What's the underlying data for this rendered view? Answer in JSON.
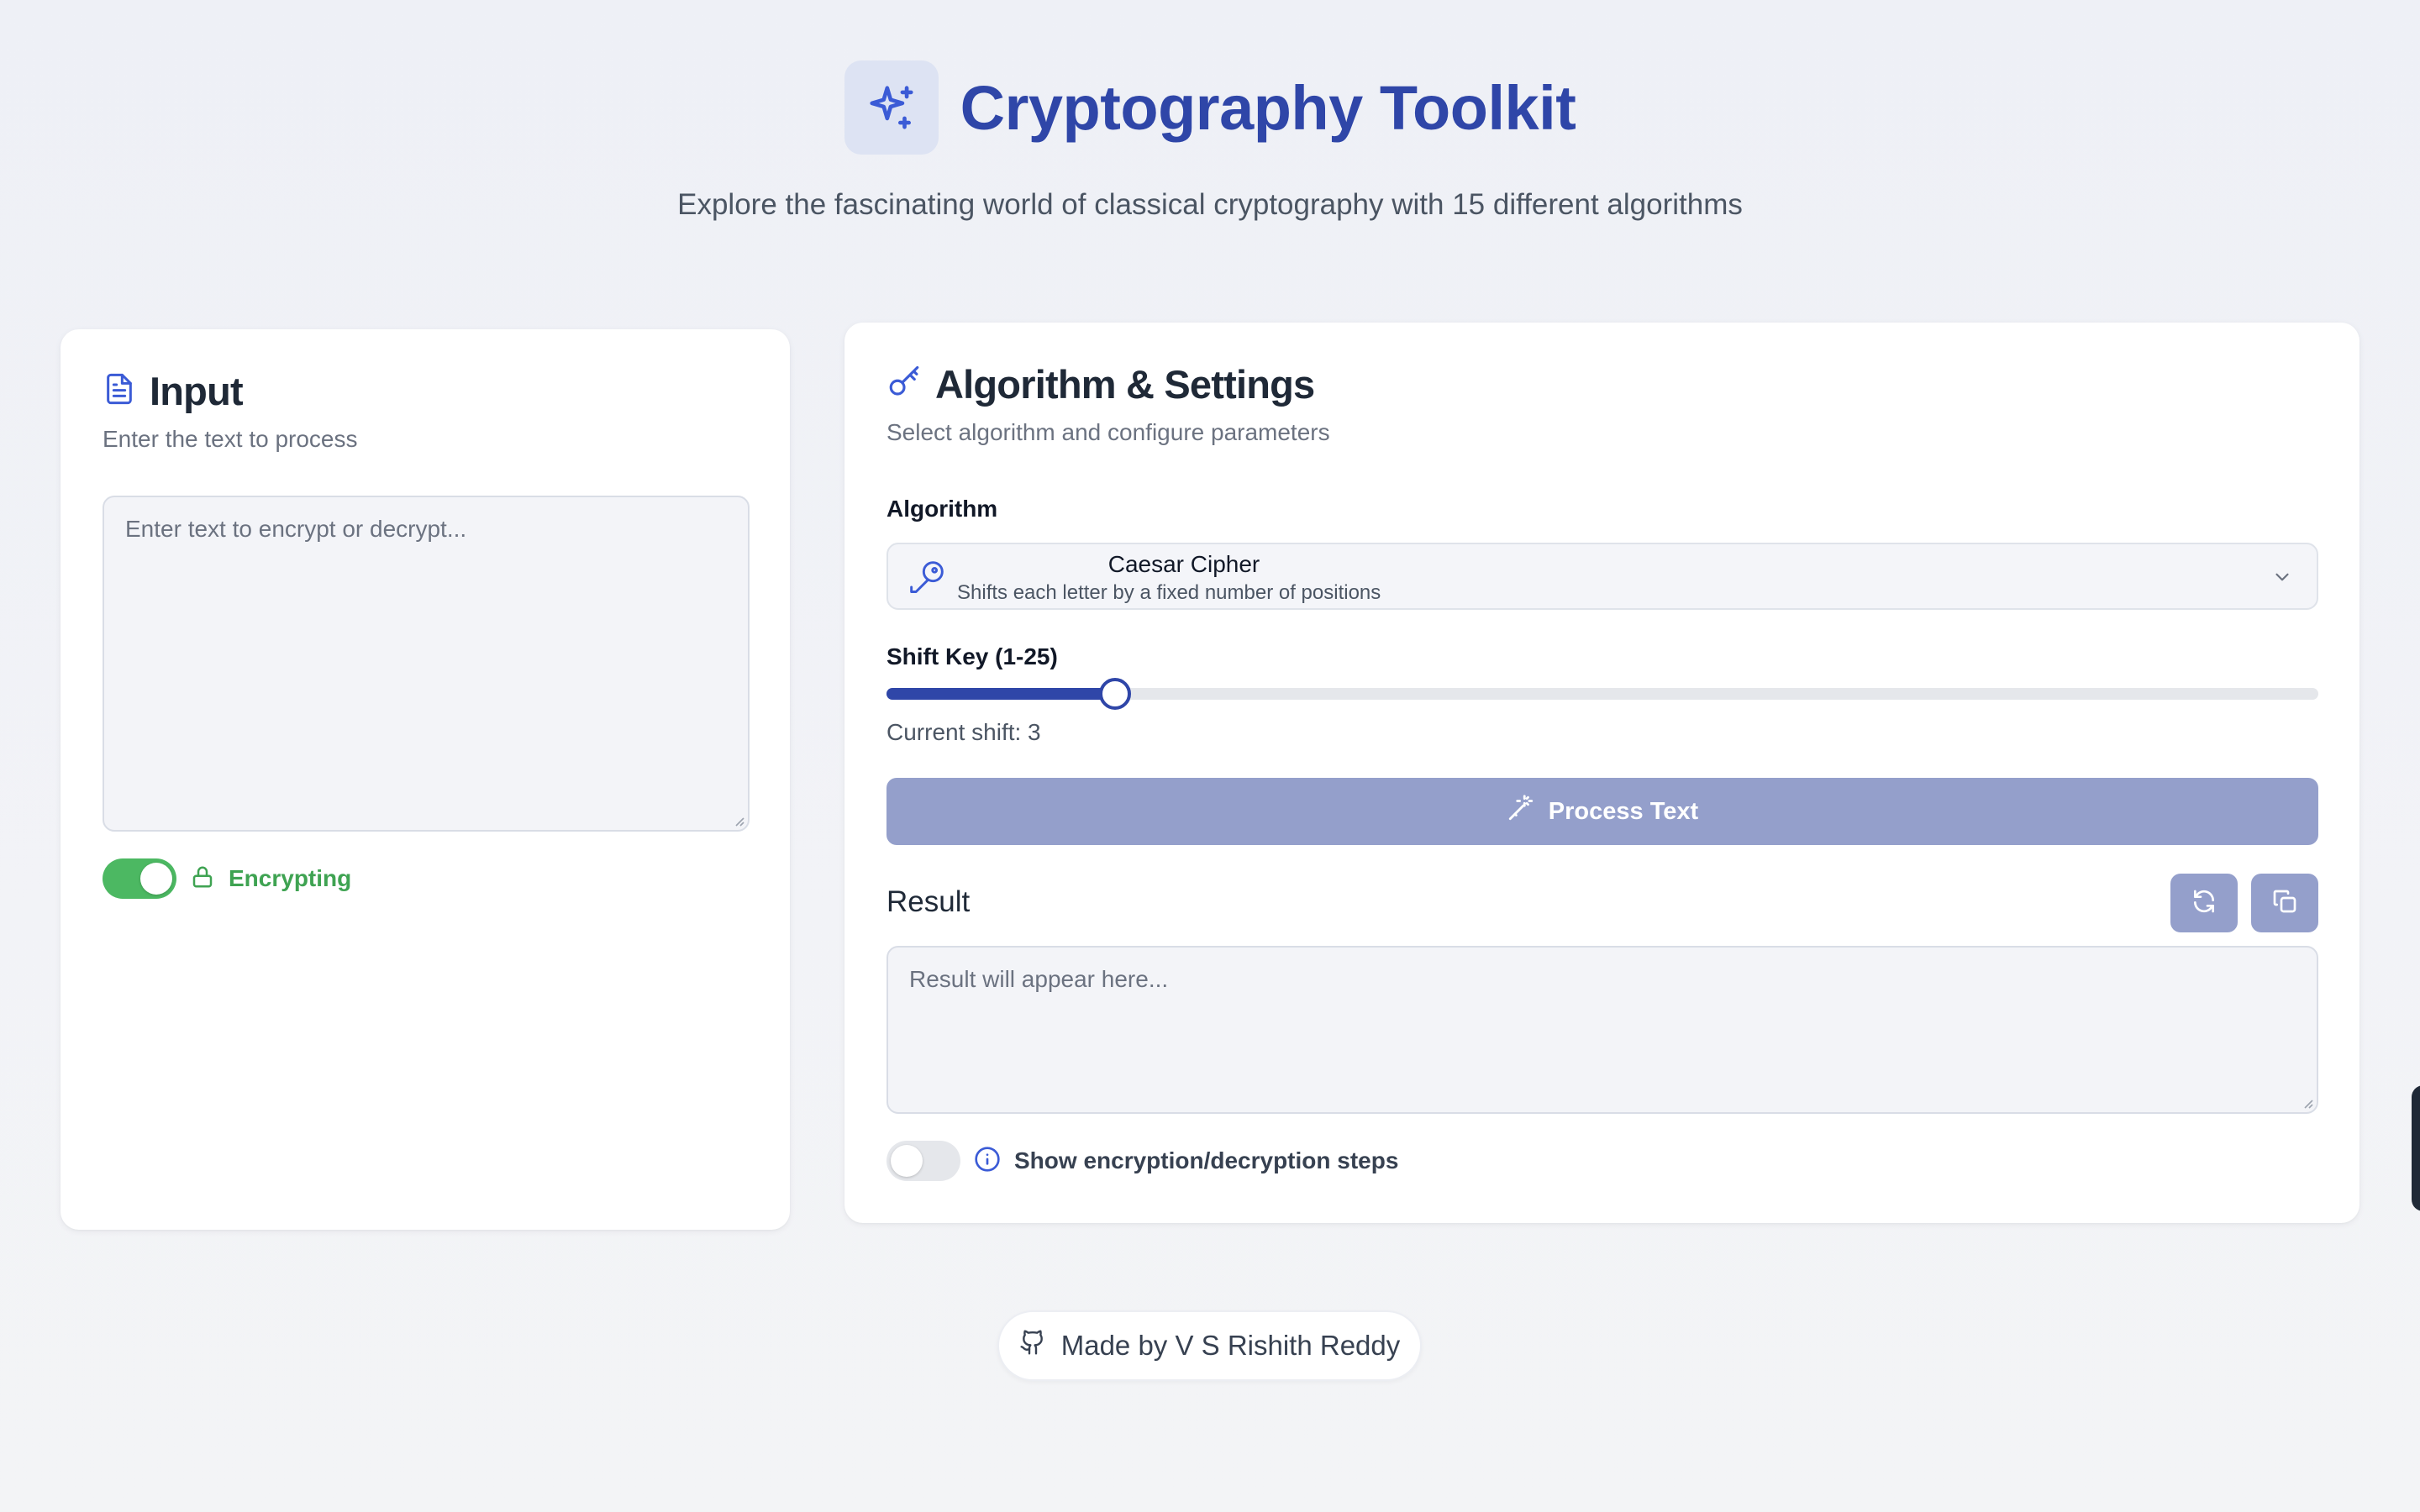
{
  "header": {
    "title": "Cryptography Toolkit",
    "subtitle": "Explore the fascinating world of classical cryptography with 15 different algorithms",
    "logo_icon": "sparkles-icon"
  },
  "input_panel": {
    "title": "Input",
    "description": "Enter the text to process",
    "textarea_placeholder": "Enter text to encrypt or decrypt...",
    "mode_toggle_on": true,
    "mode_label": "Encrypting"
  },
  "settings_panel": {
    "title": "Algorithm & Settings",
    "description": "Select algorithm and configure parameters",
    "algorithm_label": "Algorithm",
    "algorithm_selected": {
      "name": "Caesar Cipher",
      "description": "Shifts each letter by a fixed number of positions"
    },
    "shift_label": "Shift Key (1-25)",
    "shift_min": 1,
    "shift_max": 25,
    "shift_value": 3,
    "current_shift_text": "Current shift: 3",
    "process_button": "Process Text",
    "result_title": "Result",
    "result_placeholder": "Result will appear here...",
    "steps_toggle_on": false,
    "steps_label": "Show encryption/decryption steps"
  },
  "footer": {
    "credit": "Made by V S Rishith Reddy"
  },
  "colors": {
    "brand": "#2f46a8",
    "success": "#4cb862",
    "button_disabled": "#949fcb"
  }
}
